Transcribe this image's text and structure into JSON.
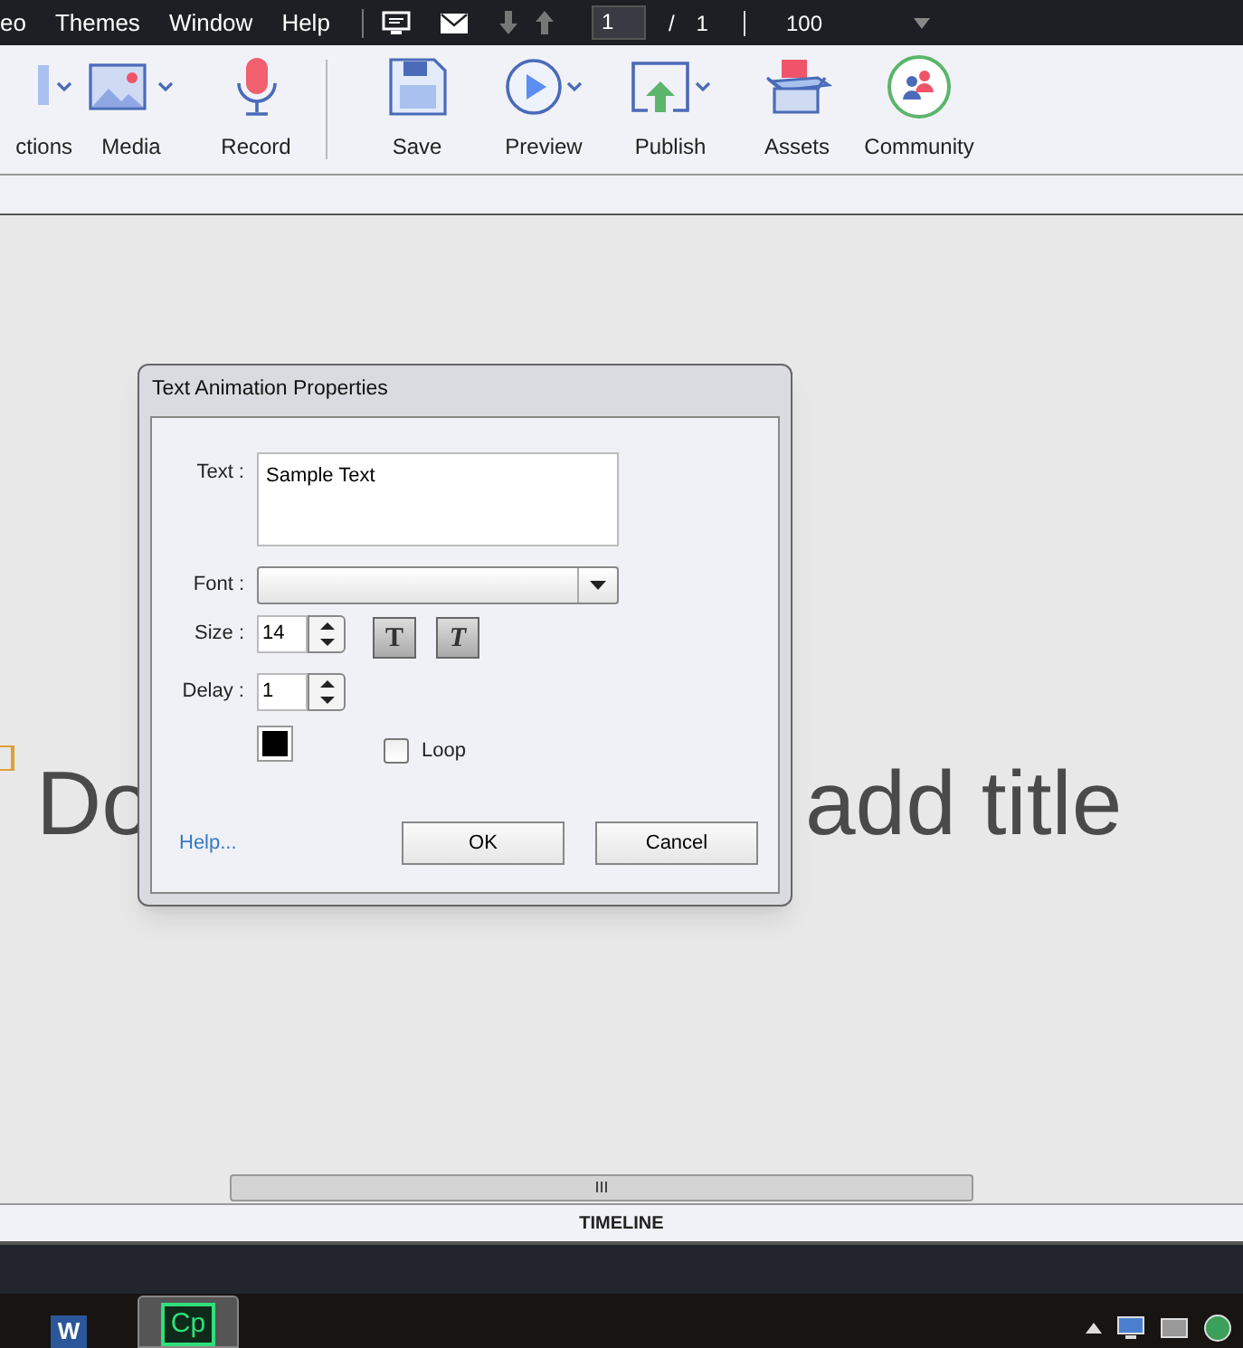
{
  "menu_bar": {
    "items": [
      "eo",
      "Themes",
      "Window",
      "Help"
    ],
    "page_field": "1",
    "page_separator": "/",
    "page_total": "1",
    "zoom": "100"
  },
  "toolbar": {
    "items": [
      {
        "kind": "interactions",
        "label": "ctions",
        "has_menu": true
      },
      {
        "kind": "media",
        "label": "Media",
        "has_menu": true
      },
      {
        "kind": "record",
        "label": "Record",
        "has_menu": false
      },
      {
        "kind": "save",
        "label": "Save",
        "has_menu": false
      },
      {
        "kind": "preview",
        "label": "Preview",
        "has_menu": true
      },
      {
        "kind": "publish",
        "label": "Publish",
        "has_menu": true
      },
      {
        "kind": "assets",
        "label": "Assets",
        "has_menu": false
      },
      {
        "kind": "community",
        "label": "Community",
        "has_menu": false
      }
    ]
  },
  "slide": {
    "title_start": "Do",
    "title_end": "add title"
  },
  "dialog": {
    "title": "Text Animation Properties",
    "text_label": "Text :",
    "text_value": "Sample Text",
    "font_label": "Font :",
    "size_label": "Size :",
    "size_value": "14",
    "bold_button": "T",
    "italic_button": "T",
    "delay_label": "Delay :",
    "delay_value": "1",
    "color": "#000000",
    "loop": {
      "label": "Loop",
      "checked": false
    },
    "help_link": "Help...",
    "ok": "OK",
    "cancel": "Cancel"
  },
  "timeline": {
    "label": "TIMELINE"
  },
  "taskbar": {
    "apps": [
      {
        "label": "W",
        "selected": false
      },
      {
        "label": "Cp",
        "selected": true
      }
    ]
  }
}
